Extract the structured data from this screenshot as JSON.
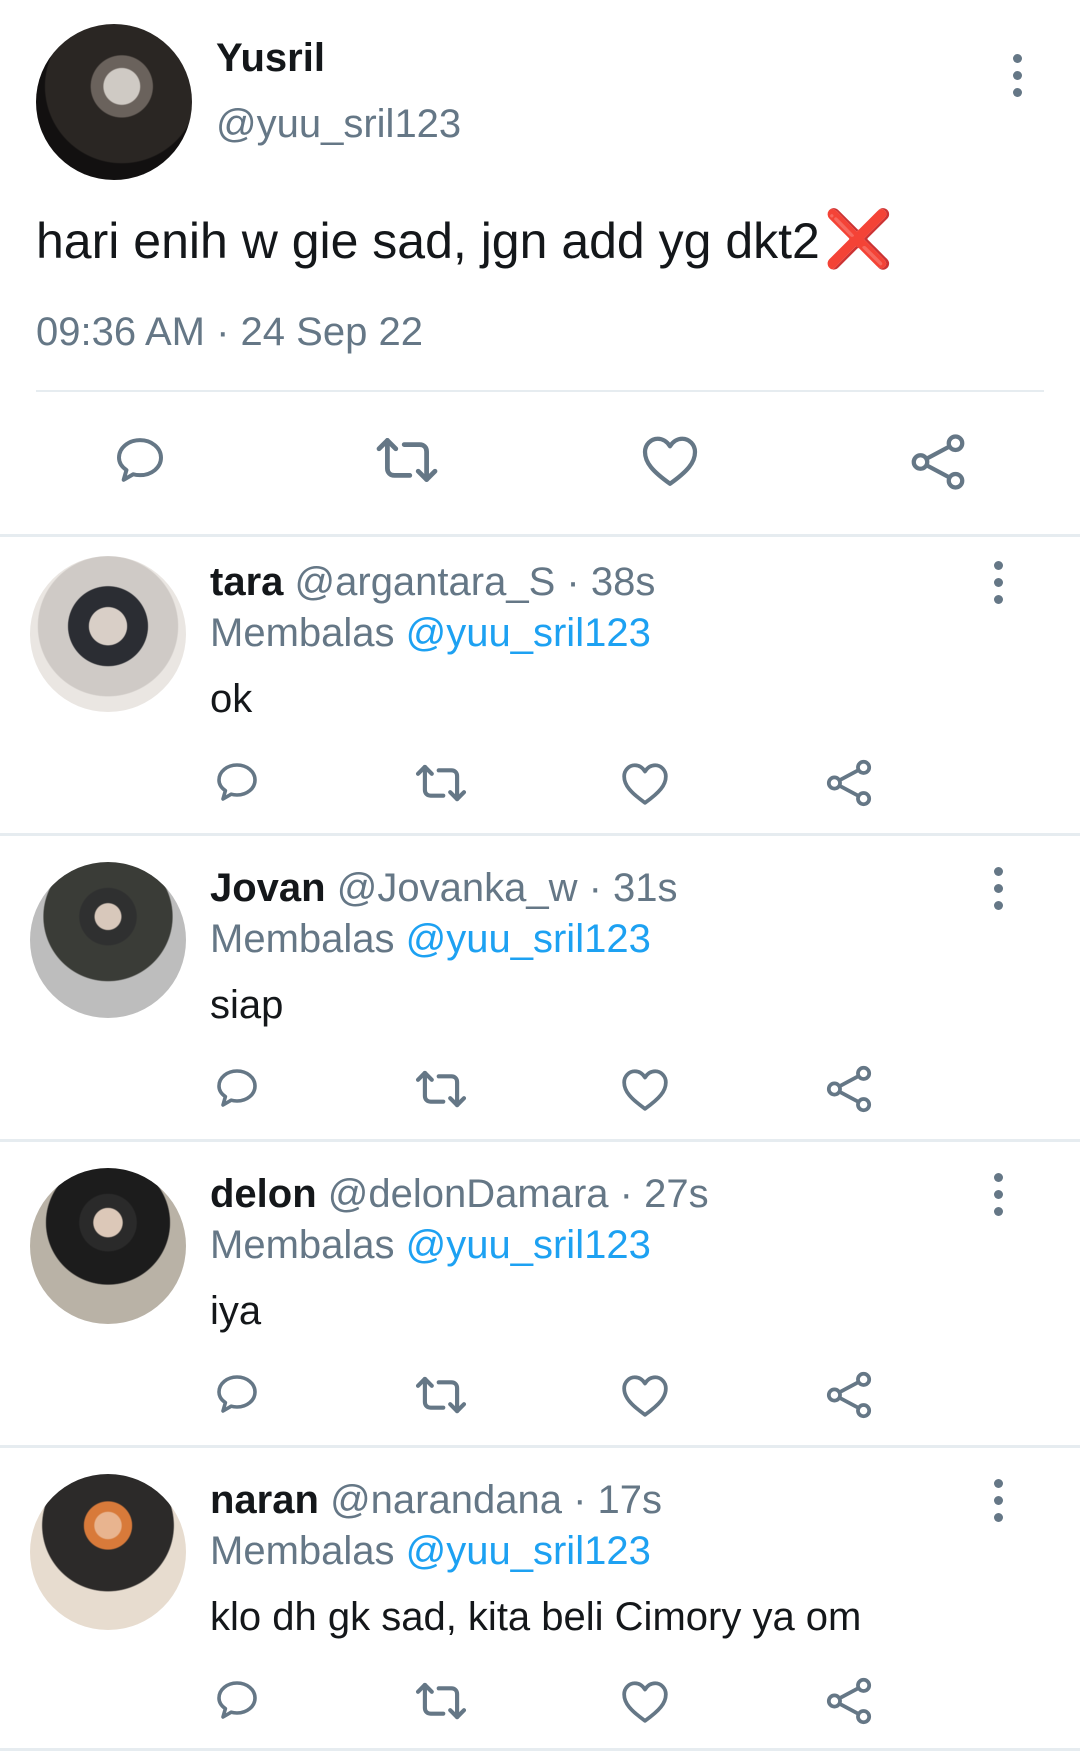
{
  "main_tweet": {
    "name": "Yusril",
    "handle": "@yuu_sril123",
    "text": "hari enih w gie sad, jgn add yg dkt2",
    "emoji": "❌",
    "timestamp": "09:36 AM · 24 Sep 22"
  },
  "replies": [
    {
      "name": "tara",
      "handle": "@argantara_S",
      "time": "· 38s",
      "replying_label": "Membalas",
      "replying_to": "@yuu_sril123",
      "text": "ok"
    },
    {
      "name": "Jovan",
      "handle": "@Jovanka_w",
      "time": "· 31s",
      "replying_label": "Membalas",
      "replying_to": "@yuu_sril123",
      "text": "siap"
    },
    {
      "name": "delon",
      "handle": "@delonDamara",
      "time": "· 27s",
      "replying_label": "Membalas",
      "replying_to": "@yuu_sril123",
      "text": "iya"
    },
    {
      "name": "naran",
      "handle": "@narandana",
      "time": "· 17s",
      "replying_label": "Membalas",
      "replying_to": "@yuu_sril123",
      "text": "klo dh gk sad, kita beli Cimory ya om"
    }
  ],
  "icons": {
    "reply": "reply-icon",
    "retweet": "retweet-icon",
    "like": "heart-icon",
    "share": "share-icon",
    "more": "more-vertical-icon"
  },
  "colors": {
    "text": "#14171a",
    "muted": "#657786",
    "mention": "#1da1f2",
    "divider": "#e6ecf0"
  }
}
